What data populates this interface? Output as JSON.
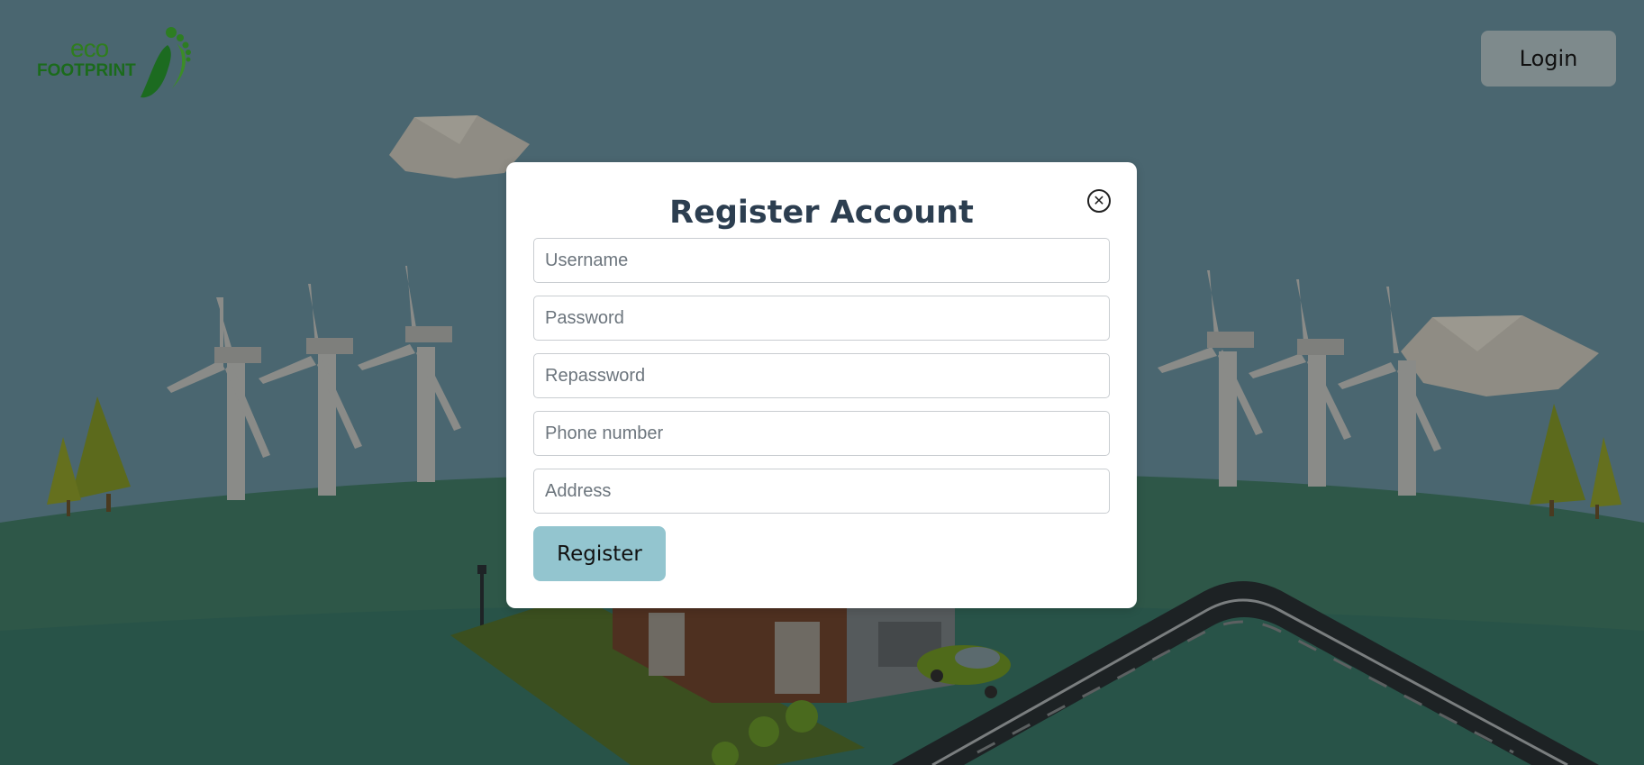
{
  "header": {
    "logo_line1": "eco",
    "logo_line2": "FOOTPRINT",
    "login_label": "Login"
  },
  "modal": {
    "title": "Register Account",
    "close_icon": "close-circle-icon",
    "fields": {
      "username_placeholder": "Username",
      "password_placeholder": "Password",
      "repassword_placeholder": "Repassword",
      "phone_placeholder": "Phone number",
      "address_placeholder": "Address"
    },
    "register_label": "Register"
  },
  "colors": {
    "overlay": "#4a6670",
    "brand_green": "#2f7d1e",
    "register_button": "#93c5cf",
    "login_button": "#7e8a8c",
    "title": "#2c3e50"
  }
}
